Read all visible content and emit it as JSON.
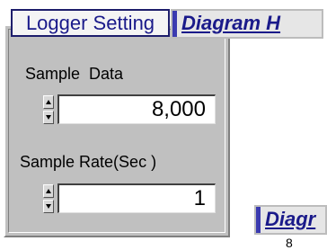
{
  "panel": {
    "title": "Logger Setting",
    "sample_data": {
      "label": "Sample  Data",
      "value": "8,000"
    },
    "sample_rate": {
      "label": "Sample Rate(Sec )",
      "value": "1"
    }
  },
  "tabs": {
    "diagram_h": "Diagram H",
    "diagram_partial": "Diagr"
  },
  "bottom_text": "8",
  "colors": {
    "panel_bg": "#c0c0c0",
    "title_text": "#1a1a8a",
    "tab_accent": "#3a3ab0"
  },
  "icons": [
    "spin-up-icon",
    "spin-down-icon"
  ]
}
